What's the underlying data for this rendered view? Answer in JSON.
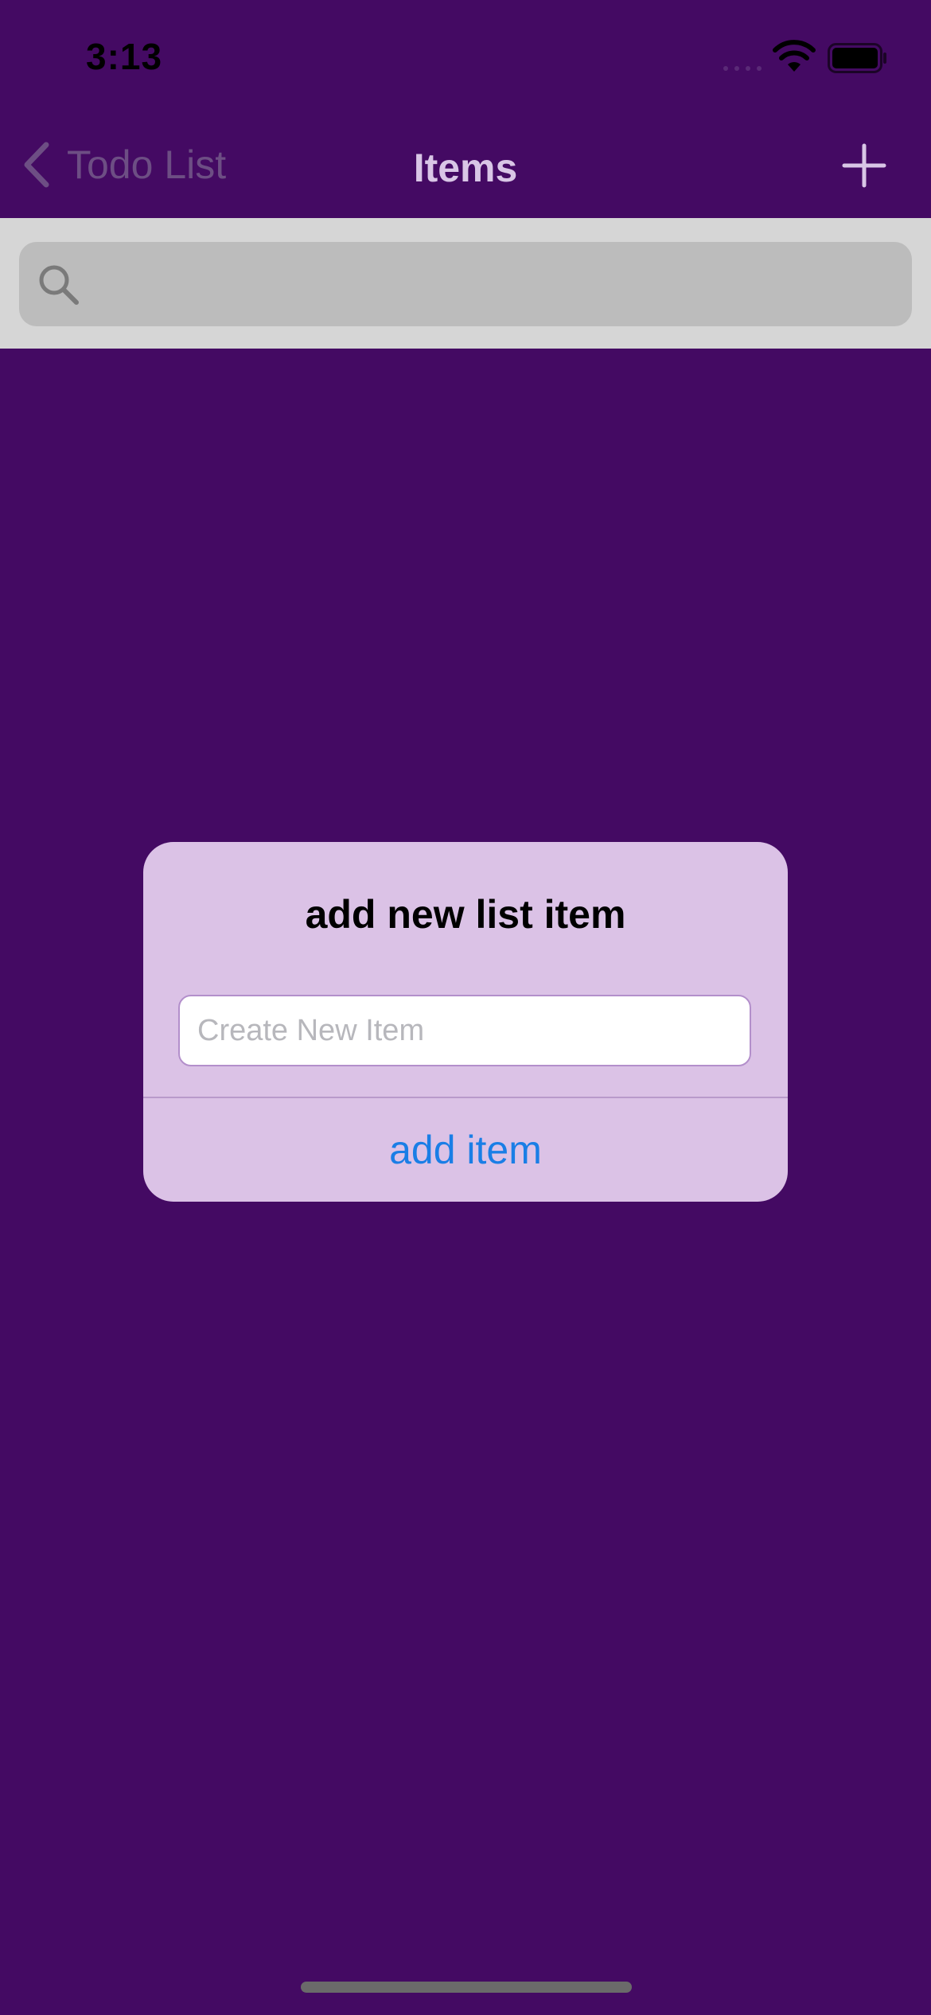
{
  "status_bar": {
    "time": "3:13"
  },
  "nav": {
    "back_label": "Todo List",
    "title": "Items"
  },
  "search": {
    "placeholder": ""
  },
  "alert": {
    "title": "add new list item",
    "input_placeholder": "Create New Item",
    "input_value": "",
    "action_label": "add item"
  },
  "colors": {
    "background": "#440a63",
    "search_area": "#d6d6d6",
    "alert_background": "#dbc2e6",
    "action_blue": "#1a7ee6"
  },
  "icons": {
    "back": "chevron-left-icon",
    "add": "plus-icon",
    "search": "search-icon",
    "wifi": "wifi-icon",
    "battery": "battery-icon",
    "signal": "signal-icon"
  }
}
